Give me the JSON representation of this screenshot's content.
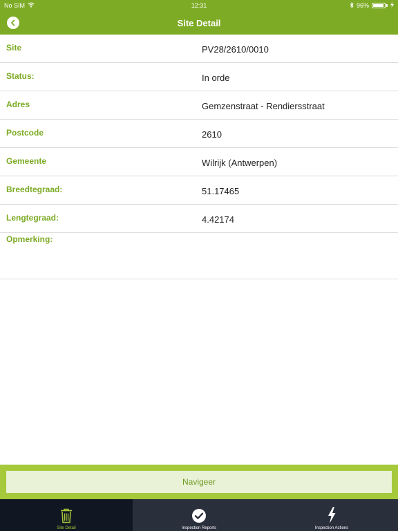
{
  "status_bar": {
    "carrier": "No SIM",
    "time": "12:31",
    "battery": "96%",
    "battery_level": 0.96
  },
  "header": {
    "title": "Site Detail",
    "back_icon": "chevron-left-circle-icon"
  },
  "details": [
    {
      "label": "Site",
      "value": "PV28/2610/0010"
    },
    {
      "label": "Status:",
      "value": "In orde"
    },
    {
      "label": "Adres",
      "value": "Gemzenstraat - Rendiersstraat"
    },
    {
      "label": "Postcode",
      "value": "2610"
    },
    {
      "label": "Gemeente",
      "value": "Wilrijk (Antwerpen)"
    },
    {
      "label": "Breedtegraad:",
      "value": "51.17465"
    },
    {
      "label": "Lengtegraad:",
      "value": "4.42174"
    },
    {
      "label": "Opmerking:",
      "value": ""
    }
  ],
  "navigate_button": {
    "label": "Navigeer"
  },
  "tabs": [
    {
      "label": "Site Detail",
      "icon": "trash-icon",
      "active": true
    },
    {
      "label": "Inspection Reports",
      "icon": "check-circle-icon",
      "active": false
    },
    {
      "label": "Inspection Actions",
      "icon": "lightning-icon",
      "active": false
    }
  ],
  "colors": {
    "accent": "#7dab25",
    "tab_bar": "#2a2f3c",
    "tab_active": "#111722",
    "button_bg": "#e9f1d6"
  }
}
